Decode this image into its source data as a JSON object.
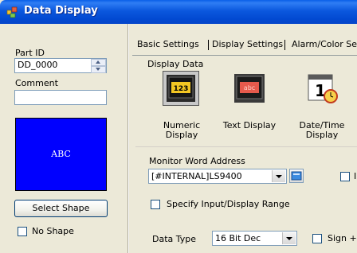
{
  "window": {
    "title": "Data Display",
    "icon": "data-display-app-icon"
  },
  "left": {
    "part_id_label": "Part ID",
    "part_id_value": "DD_0000",
    "comment_label": "Comment",
    "comment_value": "",
    "preview_text": "ABC",
    "preview_color": "#0000ff",
    "select_shape_label": "Select Shape",
    "no_shape_label": "No Shape",
    "no_shape_checked": false
  },
  "tabs": [
    {
      "label": "Basic Settings",
      "active": true
    },
    {
      "label": "Display Settings",
      "active": false
    },
    {
      "label": "Alarm/Color Set",
      "active": false
    }
  ],
  "display_data": {
    "title": "Display Data",
    "options": [
      {
        "icon": "numeric-display-icon",
        "label_line1": "Numeric",
        "label_line2": "Display",
        "selected": true
      },
      {
        "icon": "text-display-icon",
        "label_line1": "Text Display",
        "label_line2": "",
        "selected": false
      },
      {
        "icon": "date-time-display-icon",
        "label_line1": "Date/Time",
        "label_line2": "Display",
        "selected": false
      }
    ]
  },
  "monitor": {
    "label": "Monitor Word Address",
    "value": "[#INTERNAL]LS9400",
    "extra_check_label": "I"
  },
  "range": {
    "label": "Specify Input/Display Range",
    "checked": false
  },
  "data_type": {
    "label": "Data Type",
    "value": "16 Bit Dec",
    "sign_label": "Sign +"
  }
}
